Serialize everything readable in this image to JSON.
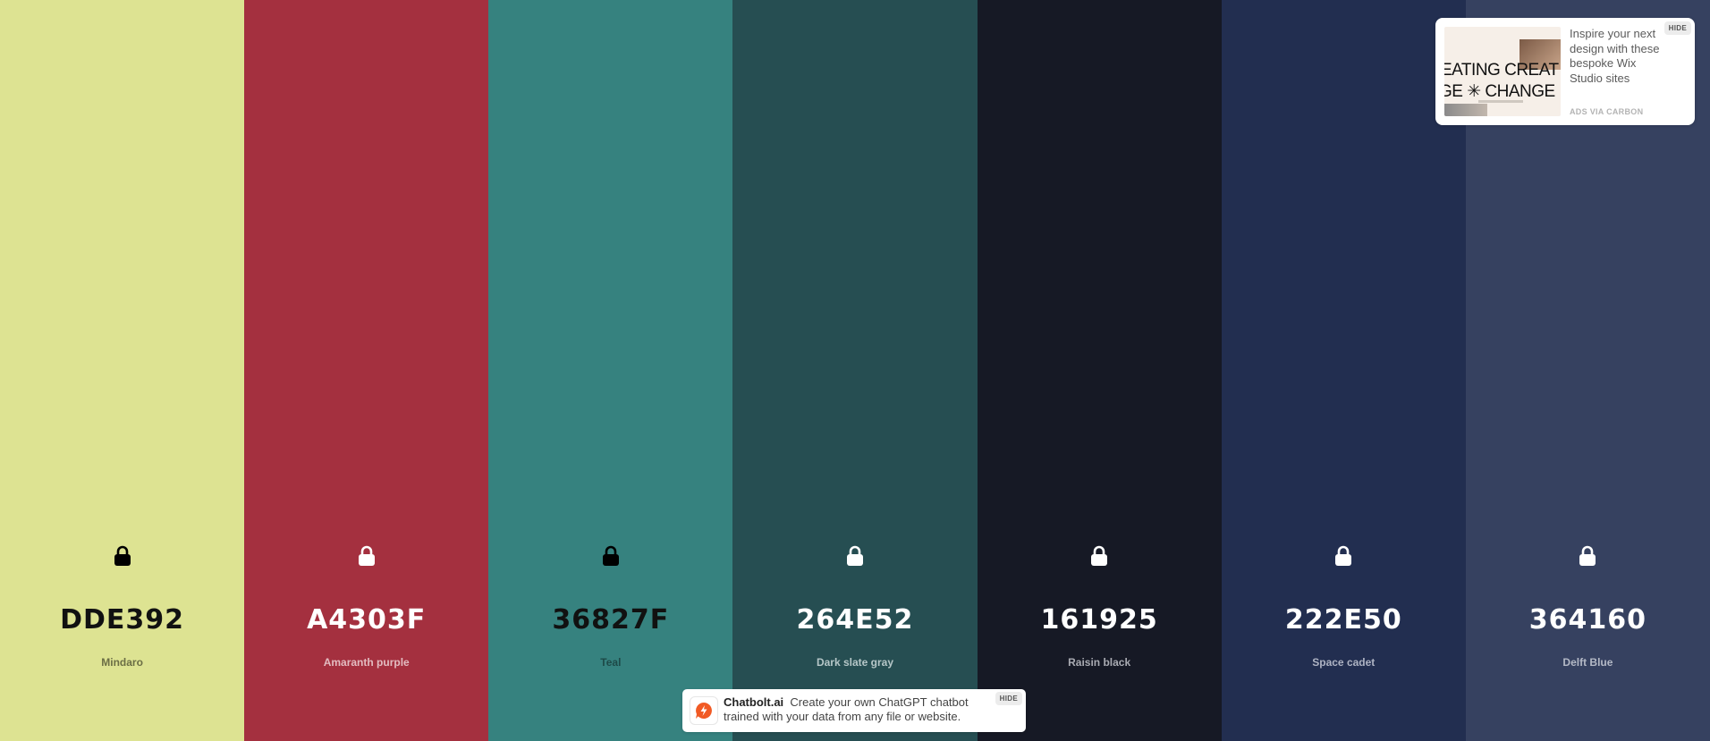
{
  "palette": {
    "colors": [
      {
        "hex": "DDE392",
        "name": "Mindaro",
        "bg": "#DDE392",
        "fg": "#111111",
        "name_color": "#6b6e45"
      },
      {
        "hex": "A4303F",
        "name": "Amaranth purple",
        "bg": "#A4303F",
        "fg": "#ffffff",
        "name_color": "#e3bcc1"
      },
      {
        "hex": "36827F",
        "name": "Teal",
        "bg": "#36827F",
        "fg": "#111111",
        "name_color": "#1e4a48"
      },
      {
        "hex": "264E52",
        "name": "Dark slate gray",
        "bg": "#264E52",
        "fg": "#ffffff",
        "name_color": "#b6c7c8"
      },
      {
        "hex": "161925",
        "name": "Raisin black",
        "bg": "#161925",
        "fg": "#ffffff",
        "name_color": "#a9abb2"
      },
      {
        "hex": "222E50",
        "name": "Space cadet",
        "bg": "#222E50",
        "fg": "#ffffff",
        "name_color": "#aeb3c3"
      },
      {
        "hex": "364160",
        "name": "Delft Blue",
        "bg": "#364160",
        "fg": "#ffffff",
        "name_color": "#b4b9c6"
      }
    ],
    "lock_icon": "lock-icon"
  },
  "carbon_ad": {
    "image_line1": "EATING CREAT",
    "image_line2": "GE ✳ CHANGE",
    "text": "Inspire your next design with these bespoke Wix Studio sites",
    "via": "ADS VIA CARBON",
    "hide": "HIDE"
  },
  "banner": {
    "brand": "Chatbolt.ai",
    "text": "Create your own ChatGPT chatbot trained with your data from any file or website.",
    "hide": "HIDE",
    "accent": "#f15a24"
  }
}
